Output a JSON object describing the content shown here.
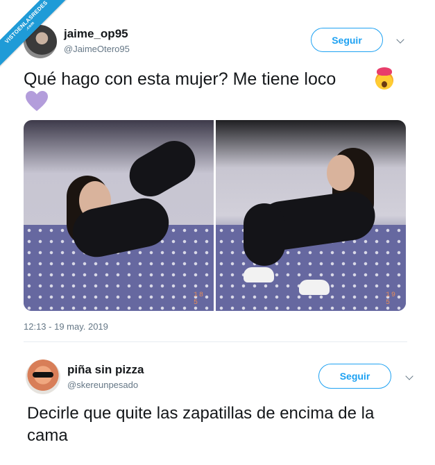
{
  "watermark": {
    "text": "VISTOENLASREDES",
    "subtext": ".com"
  },
  "tweet": {
    "author_name": "jaime_op95",
    "author_handle": "@JaimeOtero95",
    "follow_label": "Seguir",
    "text": "Qué hago con esta mujer? Me tiene loco",
    "emojis": [
      "exploding-head-emoji",
      "purple-heart-emoji"
    ],
    "photo_date_stamps": [
      "18 5",
      "19 5"
    ],
    "timestamp": "12:13 - 19 may. 2019"
  },
  "reply": {
    "author_name": "piña sin pizza",
    "author_handle": "@skereunpesado",
    "follow_label": "Seguir",
    "text": "Decirle que quite las zapatillas de encima de la cama"
  },
  "colors": {
    "accent": "#1da1f2",
    "secondary_text": "#657786",
    "primary_text": "#14171a",
    "ribbon": "#1f9bd7",
    "heart": "#b39ddb"
  }
}
